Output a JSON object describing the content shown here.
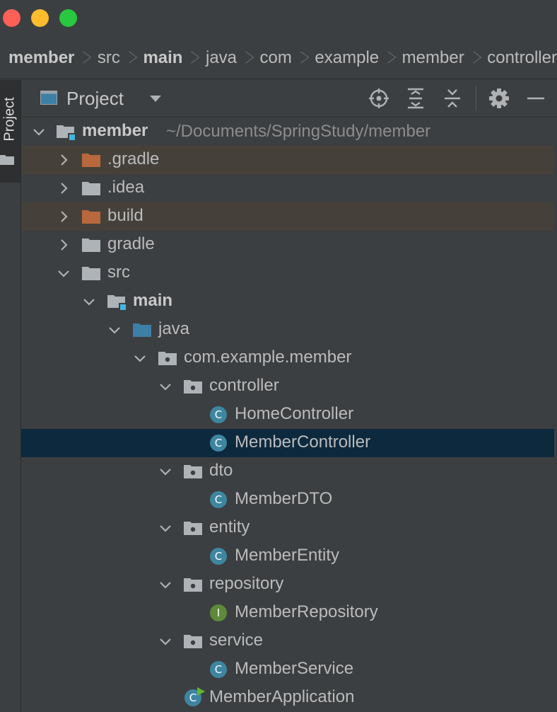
{
  "breadcrumb": [
    {
      "label": "member",
      "bold": true
    },
    {
      "label": "src",
      "bold": false
    },
    {
      "label": "main",
      "bold": true
    },
    {
      "label": "java",
      "bold": false
    },
    {
      "label": "com",
      "bold": false
    },
    {
      "label": "example",
      "bold": false
    },
    {
      "label": "member",
      "bold": false
    },
    {
      "label": "controller",
      "bold": false
    }
  ],
  "tool_window": {
    "stripe_label": "Project",
    "title": "Project",
    "toolbar_icons": [
      "locate-icon",
      "expand-all-icon",
      "collapse-all-icon",
      "gear-icon",
      "minimize-icon"
    ]
  },
  "tree": {
    "root": {
      "label": "member",
      "path": "~/Documents/SpringStudy/member"
    },
    "items": [
      {
        "label": ".gradle",
        "icon": "folder-excluded-icon"
      },
      {
        "label": ".idea",
        "icon": "folder-icon"
      },
      {
        "label": "build",
        "icon": "folder-excluded-icon"
      },
      {
        "label": "gradle",
        "icon": "folder-icon"
      },
      {
        "label": "src",
        "icon": "folder-icon"
      },
      {
        "label": "main",
        "icon": "module-folder-icon"
      },
      {
        "label": "java",
        "icon": "source-folder-icon"
      },
      {
        "label": "com.example.member",
        "icon": "package-icon"
      },
      {
        "label": "controller",
        "icon": "package-icon"
      },
      {
        "label": "HomeController",
        "icon": "class-icon",
        "badge": "C"
      },
      {
        "label": "MemberController",
        "icon": "class-icon",
        "badge": "C"
      },
      {
        "label": "dto",
        "icon": "package-icon"
      },
      {
        "label": "MemberDTO",
        "icon": "class-icon",
        "badge": "C"
      },
      {
        "label": "entity",
        "icon": "package-icon"
      },
      {
        "label": "MemberEntity",
        "icon": "class-icon",
        "badge": "C"
      },
      {
        "label": "repository",
        "icon": "package-icon"
      },
      {
        "label": "MemberRepository",
        "icon": "interface-icon",
        "badge": "I"
      },
      {
        "label": "service",
        "icon": "package-icon"
      },
      {
        "label": "MemberService",
        "icon": "class-icon",
        "badge": "C"
      },
      {
        "label": "MemberApplication",
        "icon": "spring-boot-app-icon",
        "badge": "C"
      }
    ]
  },
  "colors": {
    "background": "#3c3f41",
    "selection": "#0d293e",
    "excluded_row": "#45413a",
    "class_badge": "#3e86a0",
    "interface_badge": "#5e8a3a",
    "excluded_folder": "#b8683c",
    "source_folder": "#3d7fa6"
  }
}
